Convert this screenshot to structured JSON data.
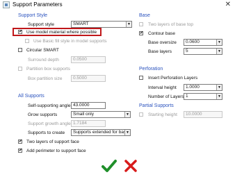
{
  "window": {
    "title": "Support Parameters",
    "close_glyph": "✕"
  },
  "support_style": {
    "section": "Support Style",
    "style_label": "Support style",
    "style_value": "SMART",
    "use_model_material_label": "Use model material where possible",
    "use_model_material_checked": true,
    "use_basic_fill_label": "Use Basic fill style in model supports",
    "circular_smart_label": "Circular SMART",
    "surround_depth_label": "Surround depth",
    "surround_depth_value": "0.0500",
    "partition_label": "Partition box supports",
    "partition_size_label": "Box partition size",
    "partition_size_value": "0.5000"
  },
  "all_supports": {
    "section": "All Supports",
    "self_supporting_label": "Self-supporting angle",
    "self_supporting_value": "43.0000",
    "grow_supports_label": "Grow supports",
    "grow_supports_value": "Small only",
    "growth_angle_label": "Support growth angle",
    "growth_angle_value": "1.7184",
    "supports_to_create_label": "Supports to create",
    "supports_to_create_value": "Supports extended for base",
    "two_layers_label": "Two layers of support face",
    "two_layers_checked": true,
    "add_perimeter_label": "Add perimeter to support face",
    "add_perimeter_checked": true
  },
  "base": {
    "section": "Base",
    "two_layers_top_label": "Two layers of base top",
    "contour_base_label": "Contour base",
    "contour_base_checked": true,
    "base_oversize_label": "Base oversize",
    "base_oversize_value": "0.0600",
    "base_layers_label": "Base layers",
    "base_layers_value": "5"
  },
  "perforation": {
    "section": "Perforation",
    "insert_label": "Insert Perforation Layers",
    "interval_label": "Interval height",
    "interval_value": "1.0000",
    "layers_label": "Number of Layers",
    "layers_value": "1"
  },
  "partial_supports": {
    "section": "Partial Supports",
    "starting_height_label": "Starting height",
    "starting_height_value": "10.0000"
  },
  "actions": {
    "ok_icon": "checkmark-icon",
    "cancel_icon": "x-icon",
    "ok_color": "#1f8f2a",
    "cancel_color": "#d81b1b"
  },
  "colors": {
    "section_text": "#2a52be",
    "highlight": "#c0171a"
  }
}
